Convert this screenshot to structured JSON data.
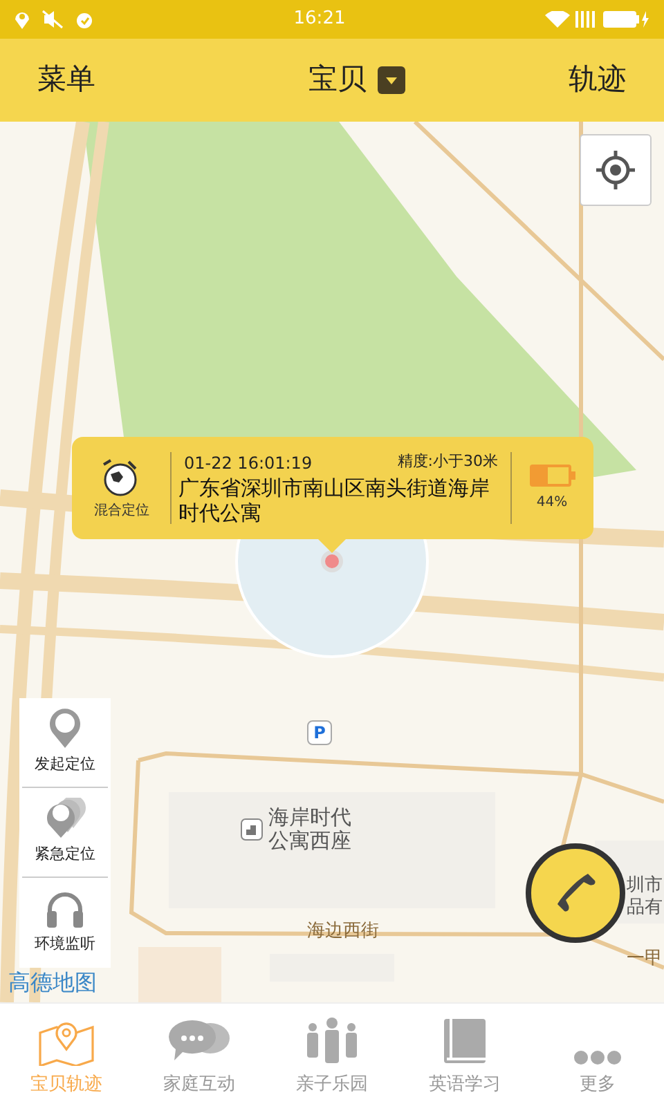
{
  "status_bar": {
    "time": "16:21"
  },
  "header": {
    "menu": "菜单",
    "title": "宝贝",
    "track": "轨迹"
  },
  "location_card": {
    "mode": "混合定位",
    "time": "01-22 16:01:19",
    "accuracy": "精度:小于30米",
    "address": "广东省深圳市南山区南头街道海岸时代公寓",
    "battery": {
      "level": 0.44,
      "reading": "44%"
    }
  },
  "side_actions": [
    {
      "label": "发起定位",
      "kind": "pin"
    },
    {
      "label": "紧急定位",
      "kind": "multi-pin"
    },
    {
      "label": "环境监听",
      "kind": "headphones"
    }
  ],
  "map_labels": [
    {
      "text": "P",
      "kind": "parking"
    },
    {
      "text": "海岸时代公寓西座",
      "kind": "poi"
    },
    {
      "text": "海边西街",
      "kind": "street"
    },
    {
      "text": "圳市",
      "kind": "plain"
    },
    {
      "text": "品有",
      "kind": "plain"
    },
    {
      "text": "一甲",
      "kind": "street"
    }
  ],
  "map_logo": "高德地图",
  "tabs": [
    {
      "label": "宝贝轨迹",
      "kind": "map",
      "selected": true
    },
    {
      "label": "家庭互动",
      "kind": "chat",
      "selected": false
    },
    {
      "label": "亲子乐园",
      "kind": "family",
      "selected": false
    },
    {
      "label": "英语学习",
      "kind": "book",
      "selected": false
    },
    {
      "label": "更多",
      "kind": "more",
      "selected": false
    }
  ]
}
